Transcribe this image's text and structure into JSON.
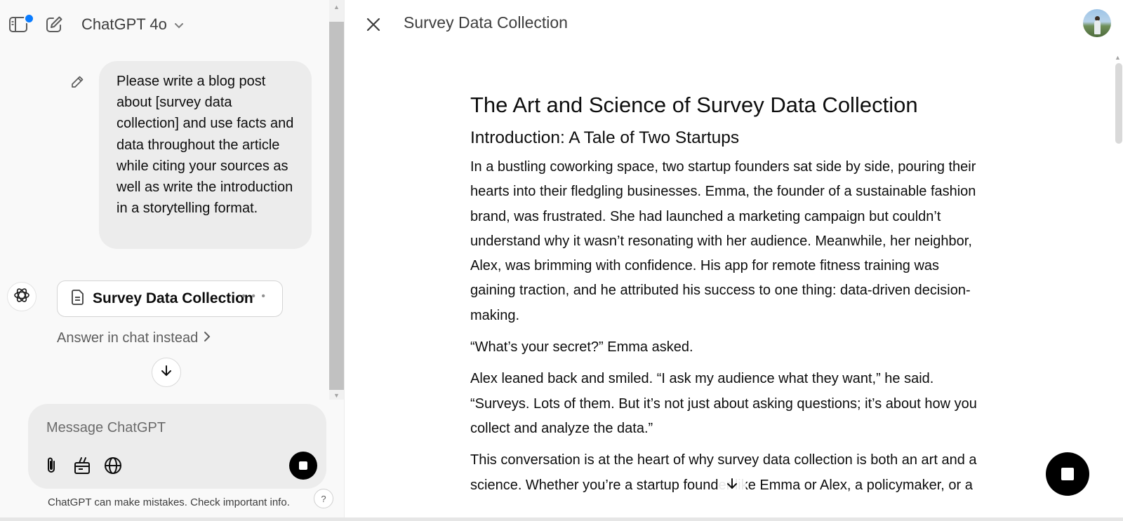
{
  "header": {
    "model_name": "ChatGPT 4o",
    "icons": {
      "sidebar_toggle": "sidebar-toggle-icon",
      "new_chat": "new-chat-icon",
      "model_chevron": "chevron-down-icon"
    },
    "notification_dot_color": "#0a7cff"
  },
  "conversation": {
    "user_message": "Please write a blog post about [survey data collection] and use facts and data throughout the article while citing your sources as well as write the introduction in a storytelling format.",
    "edit_icon": "pencil-icon",
    "assistant_icon": "openai-logo-icon",
    "canvas_card": {
      "title": "Survey Data Collection",
      "doc_icon": "document-icon",
      "more_icon": "more-options-icon"
    },
    "answer_in_chat_label": "Answer in chat instead",
    "scroll_down_icon": "arrow-down-icon"
  },
  "composer": {
    "placeholder": "Message ChatGPT",
    "icons": [
      "paperclip-icon",
      "tools-icon",
      "globe-icon"
    ],
    "stop_icon": "stop-icon"
  },
  "footer": {
    "disclaimer": "ChatGPT can make mistakes. Check important info.",
    "help_label": "?"
  },
  "canvas": {
    "title": "Survey Data Collection",
    "close_icon": "close-icon",
    "document": {
      "h1": "The Art and Science of Survey Data Collection",
      "h2": "Introduction: A Tale of Two Startups",
      "paragraphs": [
        "In a bustling coworking space, two startup founders sat side by side, pouring their hearts into their fledgling businesses. Emma, the founder of a sustainable fashion brand, was frustrated. She had launched a marketing campaign but couldn’t understand why it wasn’t resonating with her audience. Meanwhile, her neighbor, Alex, was brimming with confidence. His app for remote fitness training was gaining traction, and he attributed his success to one thing: data-driven decision-making.",
        "“What’s your secret?” Emma asked.",
        "Alex leaned back and smiled. “I ask my audience what they want,” he said. “Surveys. Lots of them. But it’s not just about asking questions; it’s about how you collect and analyze the data.”",
        "This conversation is at the heart of why survey data collection is both an art and a science. Whether you’re a startup founder like Emma or Alex, a policymaker, or a"
      ]
    }
  }
}
